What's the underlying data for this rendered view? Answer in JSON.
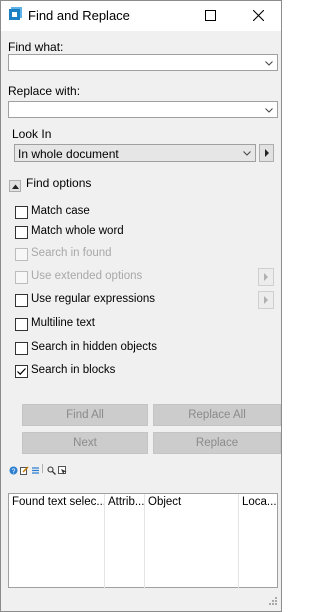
{
  "window": {
    "title": "Find and Replace",
    "accent": "#1d7fc4",
    "icons": {
      "app": "find-replace-app-icon",
      "maximize": "maximize-icon",
      "close": "close-icon"
    }
  },
  "find_what": {
    "label": "Find what:",
    "value": ""
  },
  "replace_with": {
    "label": "Replace with:",
    "value": ""
  },
  "look_in": {
    "label": "Look In",
    "selected": "In whole document"
  },
  "find_options": {
    "label": "Find options",
    "options": [
      {
        "label": "Match case",
        "checked": false,
        "enabled": true
      },
      {
        "label": "Match whole word",
        "checked": false,
        "enabled": true
      },
      {
        "label": "Search in found",
        "checked": false,
        "enabled": false
      },
      {
        "label": "Use extended options",
        "checked": false,
        "enabled": false
      },
      {
        "label": "Use regular expressions",
        "checked": false,
        "enabled": true
      },
      {
        "label": "Multiline text",
        "checked": false,
        "enabled": true
      },
      {
        "label": "Search in hidden objects",
        "checked": false,
        "enabled": true
      },
      {
        "label": "Search in blocks",
        "checked": true,
        "enabled": true
      }
    ]
  },
  "buttons": {
    "find_all": "Find All",
    "replace_all": "Replace All",
    "next": "Next",
    "replace": "Replace"
  },
  "toolbar_icons": [
    "help-icon",
    "edit-icon",
    "sort-icon",
    "zoom-icon",
    "select-icon"
  ],
  "results": {
    "columns": [
      "Found text selec...",
      "Attrib...",
      "Object",
      "Loca..."
    ],
    "rows": []
  }
}
